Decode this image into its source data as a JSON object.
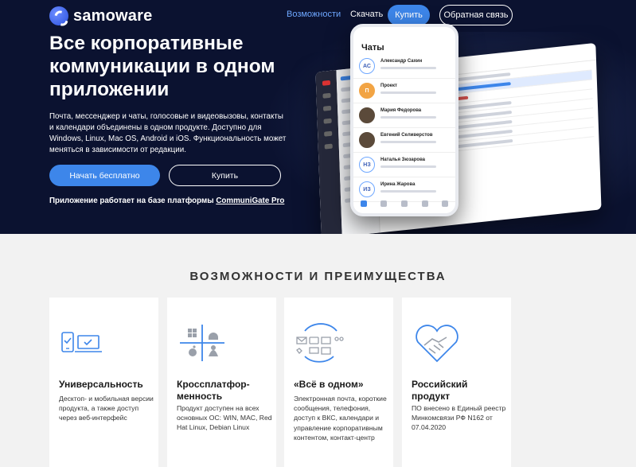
{
  "nav": {
    "brand": "samoware",
    "links": [
      {
        "label": "Возможности",
        "active": true
      },
      {
        "label": "Скачать",
        "active": false
      }
    ],
    "buy_label": "Купить",
    "feedback_label": "Обратная связь"
  },
  "hero": {
    "title": "Все корпоративные коммуникации в одном приложении",
    "description": "Почта, мессенджер и чаты, голосовые и видеовызовы, контакты и календари объединены в одном продукте. Доступно для Windows, Linux, Mac OS, Android и iOS. Функциональность может меняться в зависимости от редакции.",
    "cta_primary": "Начать бесплатно",
    "cta_secondary": "Купить",
    "platform_note_prefix": "Приложение работает на базе платформы ",
    "platform_note_link": "CommuniGate Pro"
  },
  "phone": {
    "header": "Чаты",
    "chats": [
      {
        "initials": "АС",
        "name": "Александр Сахин"
      },
      {
        "initials": "П",
        "name": "Проект"
      },
      {
        "initials": "",
        "name": "Мария Федорова"
      },
      {
        "initials": "",
        "name": "Евгений Селиверстов"
      },
      {
        "initials": "НЗ",
        "name": "Наталья Зюзарова"
      },
      {
        "initials": "ИЗ",
        "name": "Ирина Жарова"
      }
    ]
  },
  "features": {
    "title": "ВОЗМОЖНОСТИ И ПРЕИМУЩЕСТВА",
    "cards": [
      {
        "title": "Универсальность",
        "description": "Десктоп- и мобильная версии продукта, а также доступ через веб-интерфейс",
        "icon": "devices-icon"
      },
      {
        "title": "Кроссплатфор-менность",
        "description": "Продукт доступен на всех основных ОС: WIN, MAC, Red Hat Linux, Debian Linux",
        "icon": "os-platforms-icon"
      },
      {
        "title": "«Всё в одном»",
        "description": "Электронная почта, короткие сообщения, телефония, доступ к ВКС, календари и управление корпоративным контентом, контакт-центр",
        "icon": "all-in-one-icon"
      },
      {
        "title": "Российский продукт",
        "description": "ПО внесено в Единый реестр Минкомсвязи РФ N162 от 07.04.2020",
        "icon": "handshake-icon"
      }
    ]
  },
  "colors": {
    "hero_bg": "#0b1230",
    "accent": "#3d86ea",
    "nav_active": "#6ea7ff"
  }
}
